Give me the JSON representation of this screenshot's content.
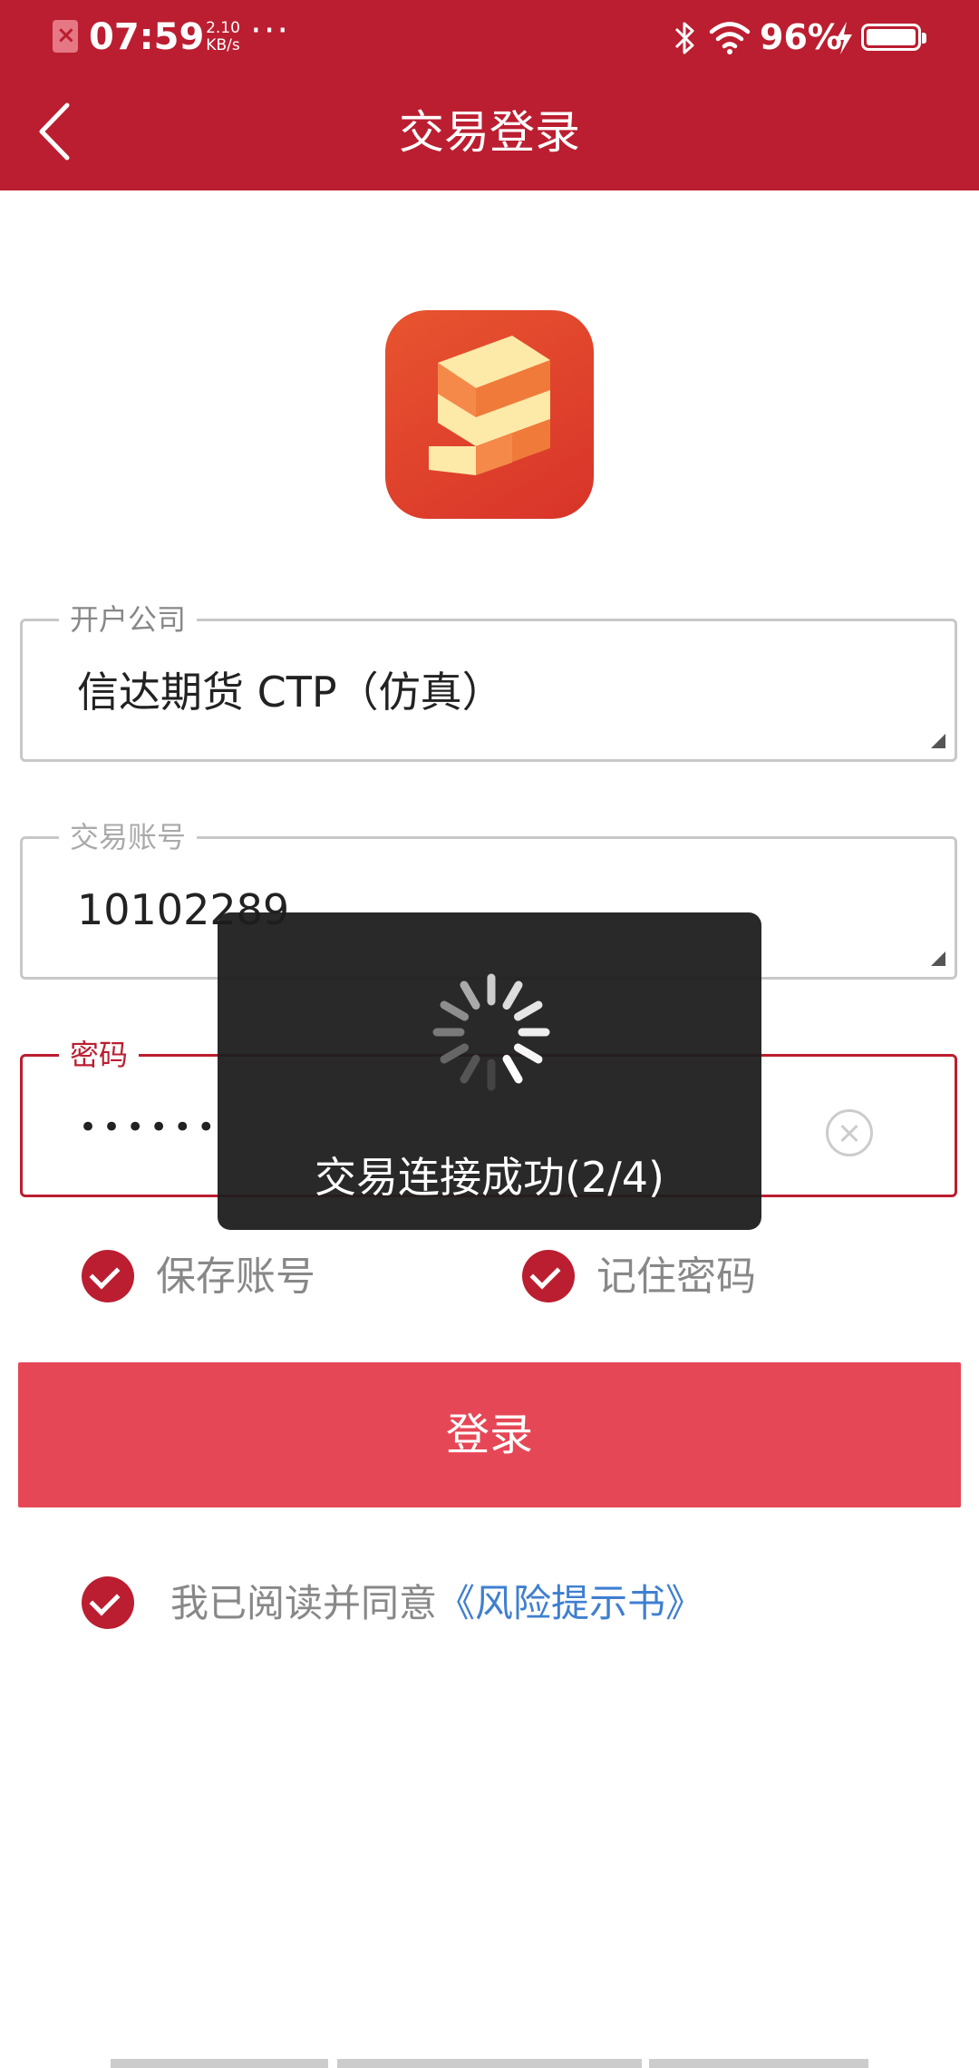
{
  "status_bar": {
    "time": "07:59",
    "speed_value": "2.10",
    "speed_unit": "KB/s",
    "overflow": "···",
    "battery": "96%"
  },
  "header": {
    "title": "交易登录"
  },
  "form": {
    "company_label": "开户公司",
    "company_value": "信达期货 CTP（仿真）",
    "account_label": "交易账号",
    "account_value": "10102289",
    "password_label": "密码",
    "password_mask": "••••••"
  },
  "options": {
    "save_account": "保存账号",
    "remember_password": "记住密码"
  },
  "login_button": "登录",
  "agreement": {
    "text": "我已阅读并同意",
    "link": "《风险提示书》"
  },
  "toast": {
    "message": "交易连接成功(2/4)"
  },
  "colors": {
    "brand": "#bb1e30",
    "button": "#e64756",
    "link": "#3f7fd0"
  }
}
